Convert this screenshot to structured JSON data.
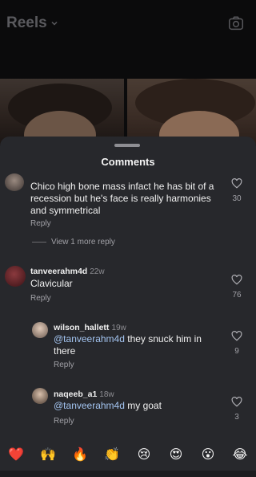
{
  "header": {
    "title": "Reels"
  },
  "sheet": {
    "title": "Comments"
  },
  "comments": [
    {
      "text": "Chico high bone mass infact he has bit of a recession but he's face is really harmonies and symmetrical",
      "likes": "30",
      "reply_label": "Reply",
      "view_more": "View 1 more reply"
    },
    {
      "user": "tanveerahm4d",
      "time": "22w",
      "text": "Clavicular",
      "likes": "76",
      "reply_label": "Reply"
    }
  ],
  "replies": [
    {
      "user": "wilson_hallett",
      "time": "19w",
      "mention": "@tanveerahm4d",
      "text": " they snuck him in there",
      "likes": "9",
      "reply_label": "Reply"
    },
    {
      "user": "naqeeb_a1",
      "time": "18w",
      "mention": "@tanveerahm4d",
      "text": " my goat",
      "likes": "3",
      "reply_label": "Reply"
    }
  ],
  "emoji_bar": [
    "❤️",
    "🙌",
    "🔥",
    "👏",
    "😢",
    "😍",
    "😮",
    "😂"
  ]
}
